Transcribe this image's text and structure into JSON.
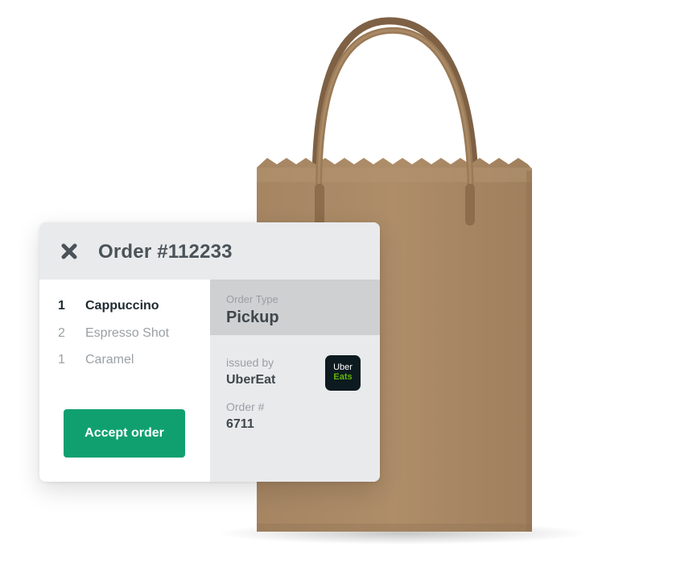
{
  "order": {
    "title": "Order #112233",
    "items": [
      {
        "qty": "1",
        "name": "Cappuccino"
      },
      {
        "qty": "2",
        "name": "Espresso Shot"
      },
      {
        "qty": "1",
        "name": "Caramel"
      }
    ],
    "accept_label": "Accept order",
    "type_label": "Order Type",
    "type_value": "Pickup",
    "issued_label": "issued by",
    "issued_value": "UberEat",
    "number_label": "Order #",
    "number_value": "6711",
    "logo": {
      "top": "Uber",
      "bottom": "Eats"
    }
  },
  "colors": {
    "accent": "#10a070",
    "header_bg": "#e9eaec",
    "type_bg": "#cfd0d2",
    "logo_bg": "#0d1a1f",
    "logo_green": "#5fb709",
    "bag": "#a98762"
  },
  "icons": {
    "close": "close-x-icon"
  }
}
